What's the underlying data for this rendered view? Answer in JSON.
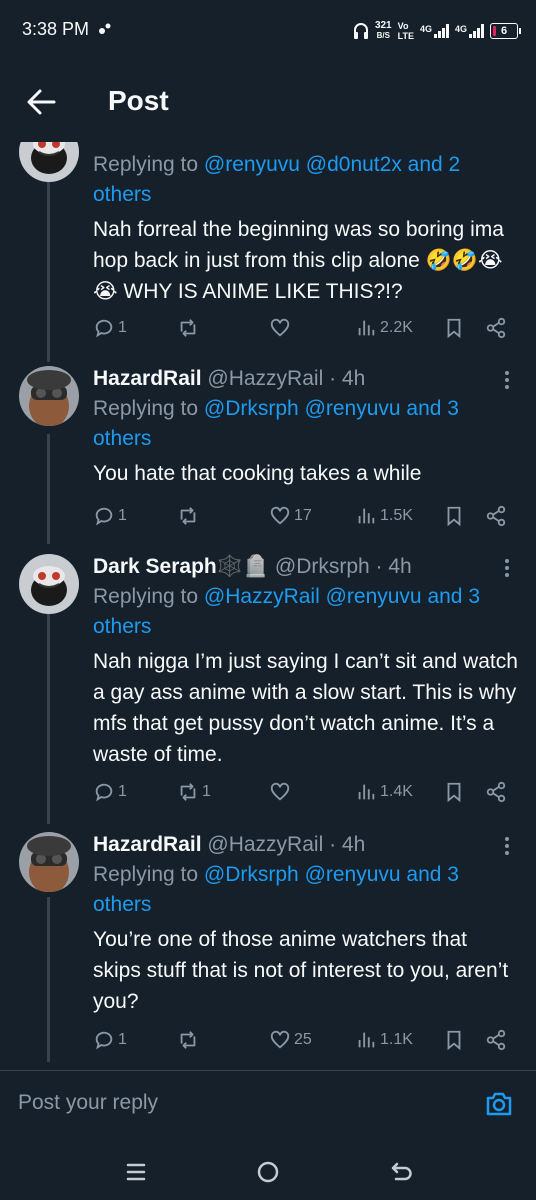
{
  "status_bar": {
    "time": "3:38 PM",
    "net_speed_value": "321",
    "net_speed_unit": "B/S",
    "volte_top": "Vo",
    "volte_bottom": "LTE",
    "sim1_label": "4G",
    "sim2_label": "4G",
    "battery_level": "6",
    "battery_color": "#e0245e"
  },
  "header": {
    "title": "Post"
  },
  "colors": {
    "background": "#15202b",
    "text": "#f7f9f9",
    "muted": "#8b98a5",
    "accent": "#1d9bf0",
    "line": "#38444d"
  },
  "replies": [
    {
      "replying_prefix": "Replying to",
      "replying_mentions": "@renyuvu @d0nut2x and 2 others",
      "text": "Nah forreal the beginning was so boring ima hop back in just from this clip alone 🤣🤣😭😭 WHY IS ANIME LIKE THIS?!?",
      "replies": "1",
      "reposts": "",
      "likes": "",
      "views": "2.2K",
      "avatar": "masked-face-avatar"
    },
    {
      "display_name": "HazardRail",
      "handle": "@HazzyRail · 4h",
      "replying_prefix": "Replying to",
      "replying_mentions": "@Drksrph @renyuvu and 3 others",
      "text": "You hate that cooking takes a while",
      "replies": "1",
      "reposts": "",
      "likes": "17",
      "views": "1.5K",
      "avatar": "person-goggles-avatar"
    },
    {
      "display_name": "Dark Seraph🕸️🪦",
      "handle": "@Drksrph · 4h",
      "replying_prefix": "Replying to",
      "replying_mentions": "@HazzyRail @renyuvu and 3 others",
      "text": "Nah nigga I’m just saying I can’t sit and watch a gay ass anime with a slow start. This is why mfs that get pussy don’t watch anime. It’s a waste of time.",
      "replies": "1",
      "reposts": "1",
      "likes": "",
      "views": "1.4K",
      "avatar": "masked-face-avatar"
    },
    {
      "display_name": "HazardRail",
      "handle": "@HazzyRail · 4h",
      "replying_prefix": "Replying to",
      "replying_mentions": "@Drksrph @renyuvu and 3 others",
      "text": "You’re one of those anime watchers that skips stuff that is not of interest to you, aren’t you?",
      "replies": "1",
      "reposts": "",
      "likes": "25",
      "views": "1.1K",
      "avatar": "person-goggles-avatar"
    }
  ],
  "composer": {
    "placeholder": "Post your reply"
  }
}
